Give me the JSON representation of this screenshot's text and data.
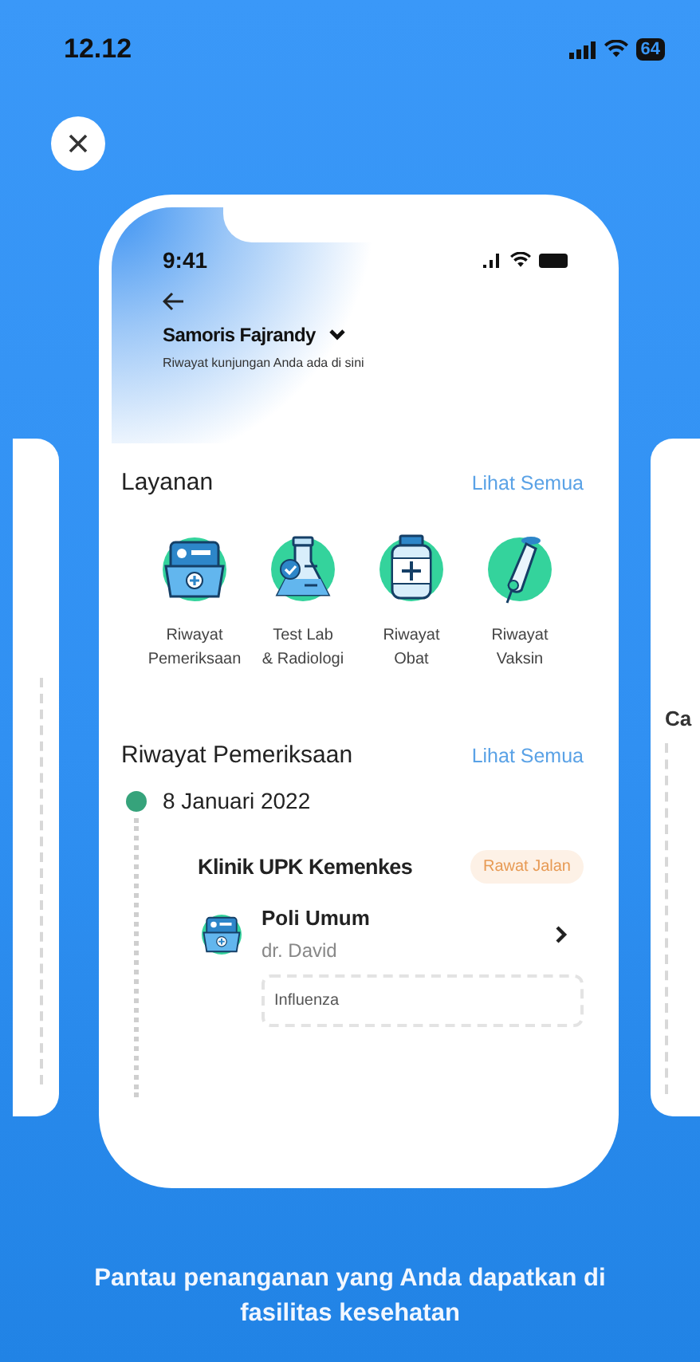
{
  "status_bar": {
    "time": "12.12",
    "battery": "64"
  },
  "phone": {
    "time": "9:41",
    "user_name": "Samoris Fajrandy",
    "subtitle": "Riwayat kunjungan Anda ada di sini",
    "services": {
      "title": "Layanan",
      "link": "Lihat Semua",
      "items": [
        {
          "kind": "folder",
          "label": "Riwayat\nPemeriksaan"
        },
        {
          "kind": "flask",
          "label": "Test Lab\n& Radiologi"
        },
        {
          "kind": "bottle",
          "label": "Riwayat\nObat"
        },
        {
          "kind": "syringe",
          "label": "Riwayat\nVaksin"
        }
      ]
    },
    "history": {
      "title": "Riwayat Pemeriksaan",
      "link": "Lihat Semua",
      "entries": [
        {
          "date": "8 Januari 2022",
          "clinic": "Klinik UPK Kemenkes",
          "tag": "Rawat Jalan",
          "visit": "Poli Umum",
          "doctor": "dr. David",
          "diagnosis": "Influenza"
        }
      ]
    }
  },
  "next_card": {
    "heading": "Ca"
  },
  "caption": "Pantau penanganan yang Anda dapatkan di fasilitas kesehatan"
}
